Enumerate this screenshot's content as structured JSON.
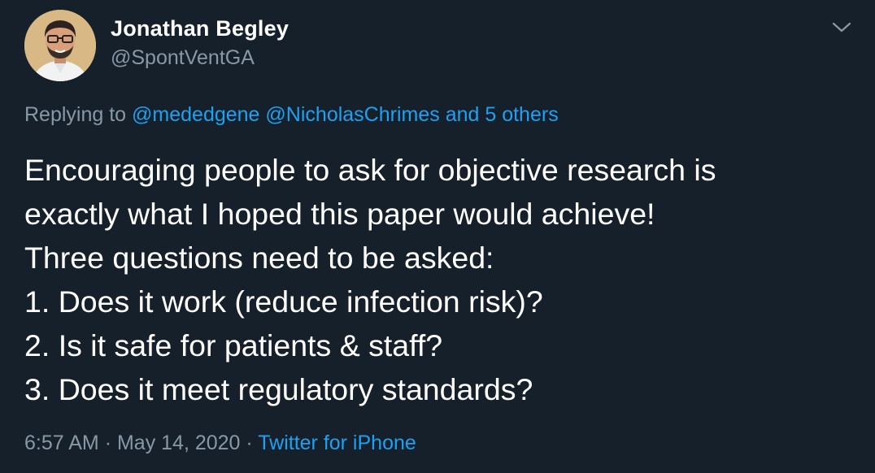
{
  "author": {
    "name": "Jonathan Begley",
    "handle": "@SpontVentGA"
  },
  "reply": {
    "prefix": "Replying to",
    "mention1": "@mededgene",
    "mention2": "@NicholasChrimes",
    "and_others": "and 5 others"
  },
  "tweet": {
    "lines": [
      "Encouraging people to ask for objective research is",
      "exactly what I hoped this paper would achieve!",
      "Three questions need to be asked:",
      "1. Does it work (reduce infection risk)?",
      "2. Is it safe for patients & staff?",
      "3. Does it meet regulatory standards?"
    ]
  },
  "meta": {
    "time": "6:57 AM",
    "separator": "·",
    "date": "May 14, 2020",
    "source": "Twitter for iPhone"
  },
  "icons": {
    "more": "chevron-down-icon",
    "avatar": "avatar"
  },
  "colors": {
    "background": "#15202b",
    "text": "#ffffff",
    "secondary": "#8899a6",
    "link": "#1da1f2"
  }
}
